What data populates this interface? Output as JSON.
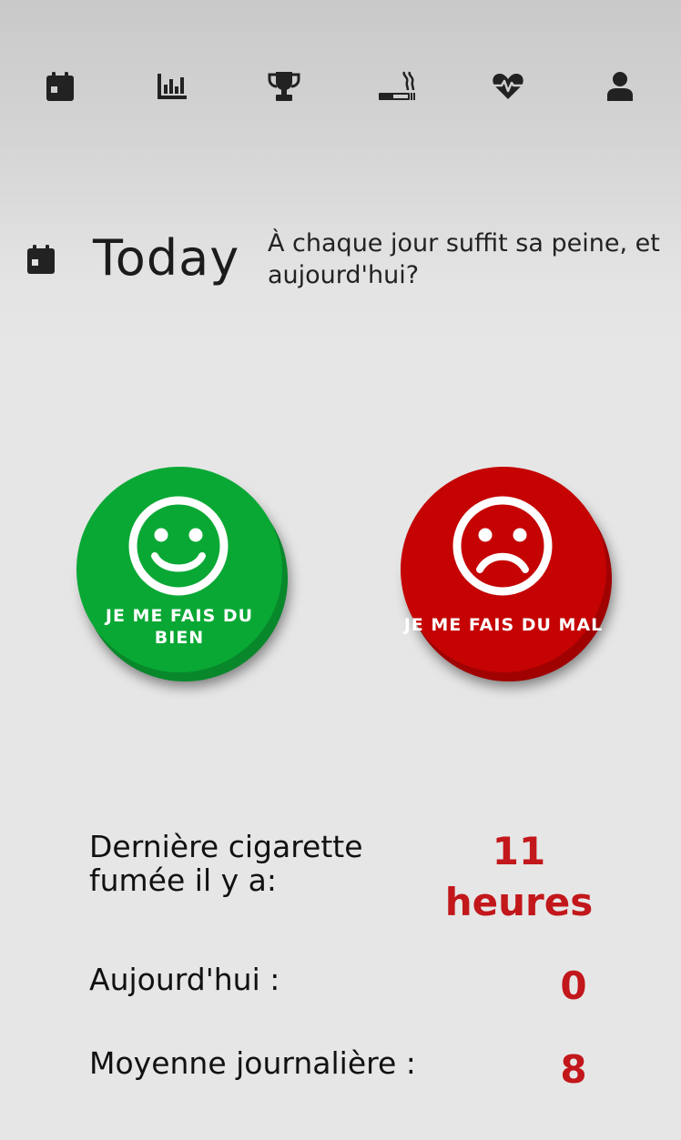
{
  "nav": {
    "items": [
      {
        "icon": "calendar-icon"
      },
      {
        "icon": "stats-icon"
      },
      {
        "icon": "trophy-icon"
      },
      {
        "icon": "cigarette-icon"
      },
      {
        "icon": "heartbeat-icon"
      },
      {
        "icon": "user-icon"
      }
    ]
  },
  "header": {
    "icon": "calendar-icon",
    "title": "Today",
    "subtitle": "À chaque jour suffit sa peine, et aujourd'hui?"
  },
  "mood": {
    "good_label": "JE ME FAIS DU BIEN",
    "bad_label": "JE ME FAIS DU MAL",
    "good_color": "#09a834",
    "bad_color": "#c50303"
  },
  "stats": {
    "last_cigarette_label": "Dernière cigarette fumée il y a:",
    "last_cigarette_value": "11",
    "last_cigarette_unit": "heures",
    "today_label": "Aujourd'hui :",
    "today_value": "0",
    "average_label": "Moyenne journalière :",
    "average_value": "8",
    "value_color": "#c2171b"
  }
}
